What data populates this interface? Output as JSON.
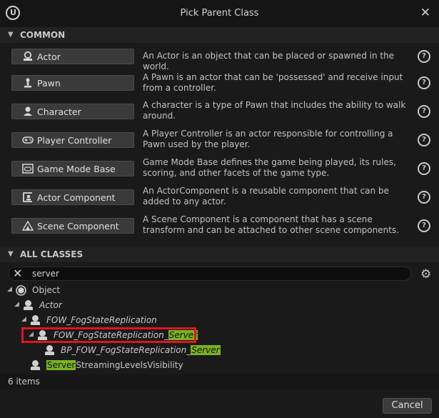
{
  "window": {
    "title": "Pick Parent Class"
  },
  "common": {
    "label": "COMMON",
    "items": [
      {
        "label": "Actor",
        "icon": "actor-icon",
        "desc": "An Actor is an object that can be placed or spawned in the world."
      },
      {
        "label": "Pawn",
        "icon": "pawn-icon",
        "desc": "A Pawn is an actor that can be 'possessed' and receive input from a controller."
      },
      {
        "label": "Character",
        "icon": "character-icon",
        "desc": "A character is a type of Pawn that includes the ability to walk around."
      },
      {
        "label": "Player Controller",
        "icon": "gamepad-icon",
        "desc": "A Player Controller is an actor responsible for controlling a Pawn used by the player."
      },
      {
        "label": "Game Mode Base",
        "icon": "game-mode-icon",
        "desc": "Game Mode Base defines the game being played, its rules, scoring, and other facets of the game type."
      },
      {
        "label": "Actor Component",
        "icon": "actor-component-icon",
        "desc": "An ActorComponent is a reusable component that can be added to any actor."
      },
      {
        "label": "Scene Component",
        "icon": "scene-component-icon",
        "desc": "A Scene Component is a component that has a scene transform and can be attached to other scene components."
      }
    ]
  },
  "all_classes": {
    "label": "ALL CLASSES",
    "search_value": "server",
    "tree": [
      {
        "pre": "Object",
        "match": "",
        "post": ""
      },
      {
        "pre": "Actor",
        "match": "",
        "post": ""
      },
      {
        "pre": "FOW_FogStateReplication",
        "match": "",
        "post": ""
      },
      {
        "pre": "FOW_FogStateReplication_",
        "match": "Server",
        "post": ""
      },
      {
        "pre": "BP_FOW_FogStateReplication_",
        "match": "Server",
        "post": ""
      },
      {
        "pre": "",
        "match": "Server",
        "post": "StreamingLevelsVisibility"
      }
    ],
    "count": "6 items"
  },
  "footer": {
    "cancel_label": "Cancel"
  },
  "colors": {
    "highlight": "#79b321",
    "selection_outline": "#e0151b"
  }
}
